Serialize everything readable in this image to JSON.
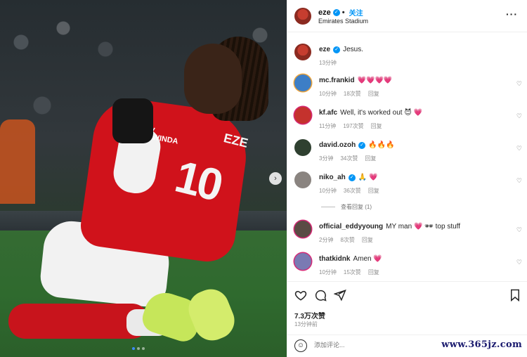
{
  "media": {
    "shirt_name": "EZE",
    "shirt_number": "10",
    "sponsor_text": "ly\nAWINDA",
    "next_icon": "chevron-right-icon",
    "dots_count": 3,
    "active_dot": 0
  },
  "header": {
    "username": "eze",
    "follow_label": "关注",
    "location": "Emirates Stadium",
    "more_icon": "more-horizontal-icon"
  },
  "caption": {
    "username": "eze",
    "text": "Jesus.",
    "time": "13分钟"
  },
  "comments": [
    {
      "username": "mc.frankid",
      "text": "💗💗💗💗",
      "time": "10分钟",
      "likes": "18次赞",
      "reply": "回复",
      "avatar_color": "#3d7ec6"
    },
    {
      "username": "kf.afc",
      "text": "Well, it's worked out 😈 💗",
      "time": "11分钟",
      "likes": "197次赞",
      "reply": "回复",
      "avatar_color": "#c4322d"
    },
    {
      "username": "david.ozoh",
      "text": "🔥🔥🔥",
      "time": "3分钟",
      "likes": "34次赞",
      "reply": "回复",
      "avatar_color": "#2f4030",
      "verified": true
    },
    {
      "username": "niko_ah",
      "text": "🙏 💗",
      "time": "10分钟",
      "likes": "36次赞",
      "reply": "回复",
      "avatar_color": "#8a8480",
      "verified": true
    },
    {
      "username": "official_eddyyoung",
      "text": "MY man 💗 🕶 top stuff",
      "time": "2分钟",
      "likes": "8次赞",
      "reply": "回复",
      "avatar_color": "#5a4b44"
    },
    {
      "username": "thatkidnk",
      "text": "Amen 💗",
      "time": "10分钟",
      "likes": "15次赞",
      "reply": "回复",
      "avatar_color": "#7a7ab3"
    }
  ],
  "view_replies": "查看回复 (1)",
  "actions": {
    "like_icon": "heart-icon",
    "comment_icon": "comment-icon",
    "share_icon": "send-icon",
    "save_icon": "bookmark-icon"
  },
  "likes_count": "7.3万次赞",
  "posted_time": "13分钟前",
  "add_comment": {
    "placeholder": "添加评论...",
    "emoji_icon": "smile-icon"
  },
  "watermark": "www.365jz.com"
}
